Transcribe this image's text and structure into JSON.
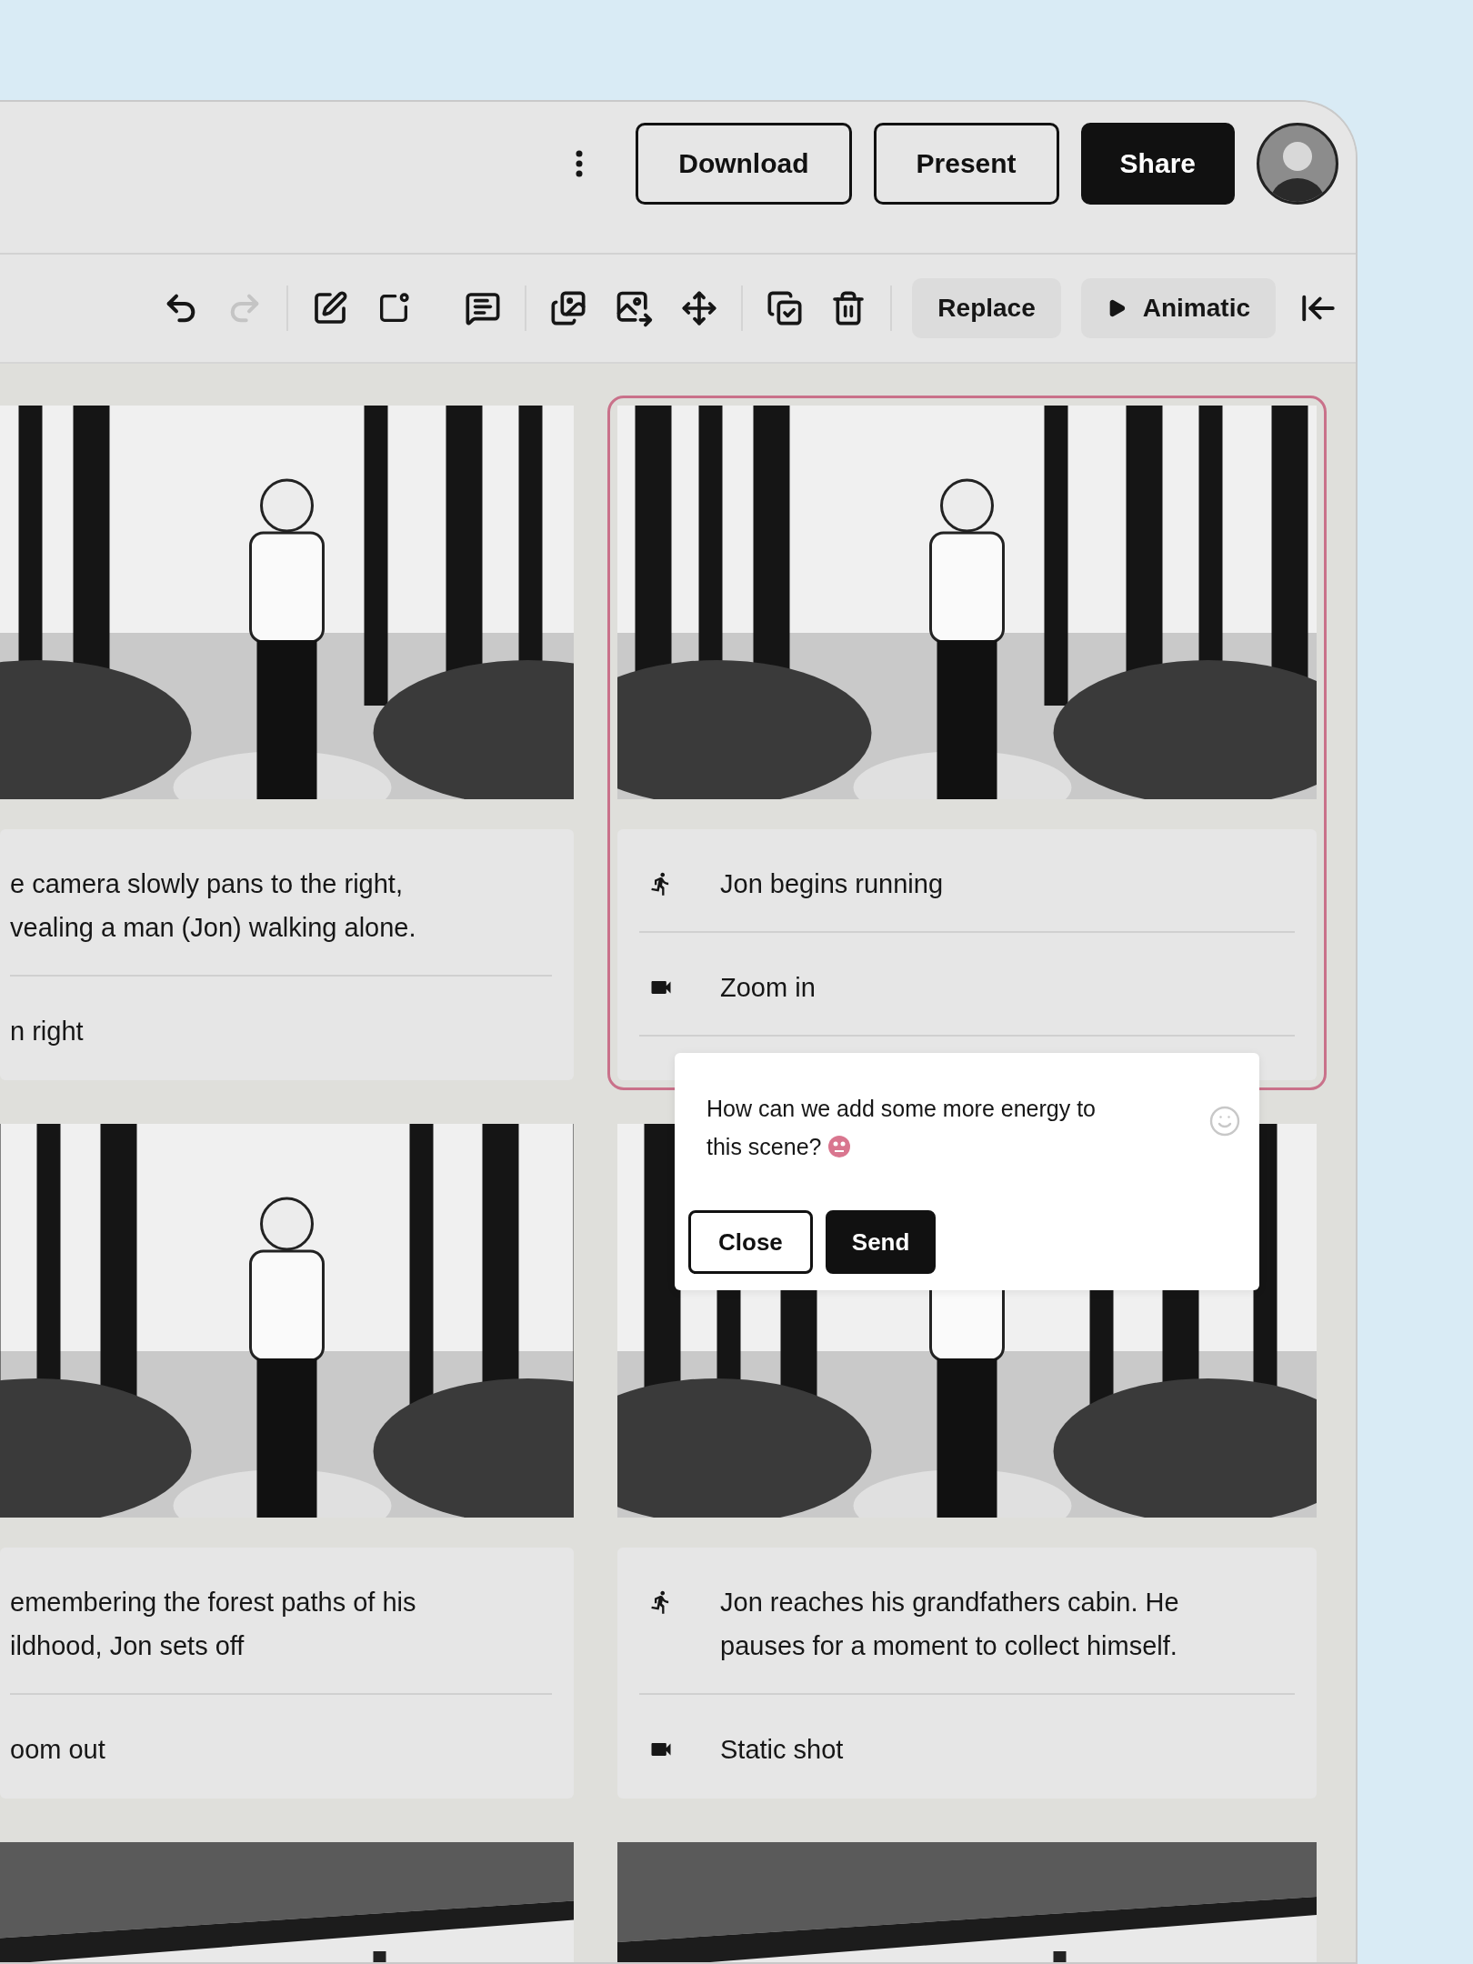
{
  "header": {
    "buttons": [
      {
        "label": "Download",
        "kind": "outline"
      },
      {
        "label": "Present",
        "kind": "outline"
      },
      {
        "label": "Share",
        "kind": "primary"
      }
    ]
  },
  "toolbar": {
    "undo": {
      "disabled": false
    },
    "redo": {
      "disabled": true
    },
    "buttons": [
      {
        "label": "Replace",
        "kind": "plain"
      },
      {
        "label": "Animatic",
        "kind": "play"
      }
    ]
  },
  "frames": [
    {
      "selected": false,
      "rows": [
        {
          "kind": "action",
          "text": "e camera slowly pans to the right,\nvealing a man (Jon) walking alone."
        },
        {
          "kind": "camera",
          "text": "n right"
        }
      ]
    },
    {
      "selected": true,
      "rows": [
        {
          "kind": "action",
          "text": "Jon begins running"
        },
        {
          "kind": "camera",
          "text": "Zoom in"
        }
      ]
    },
    {
      "selected": false,
      "rows": [
        {
          "kind": "action",
          "text": "emembering the forest paths of his\nildhood, Jon sets off"
        },
        {
          "kind": "camera",
          "text": "oom out"
        }
      ]
    },
    {
      "selected": false,
      "rows": [
        {
          "kind": "action",
          "text": "Jon reaches his grandfathers cabin. He\npauses for a moment to collect himself."
        },
        {
          "kind": "camera",
          "text": "Static shot"
        }
      ]
    },
    {
      "selected": false
    },
    {
      "selected": false
    }
  ],
  "comment": {
    "text": "How can we add some more energy to this scene?",
    "buttons": [
      {
        "label": "Close",
        "kind": "outline"
      },
      {
        "label": "Send",
        "kind": "primary"
      }
    ]
  }
}
